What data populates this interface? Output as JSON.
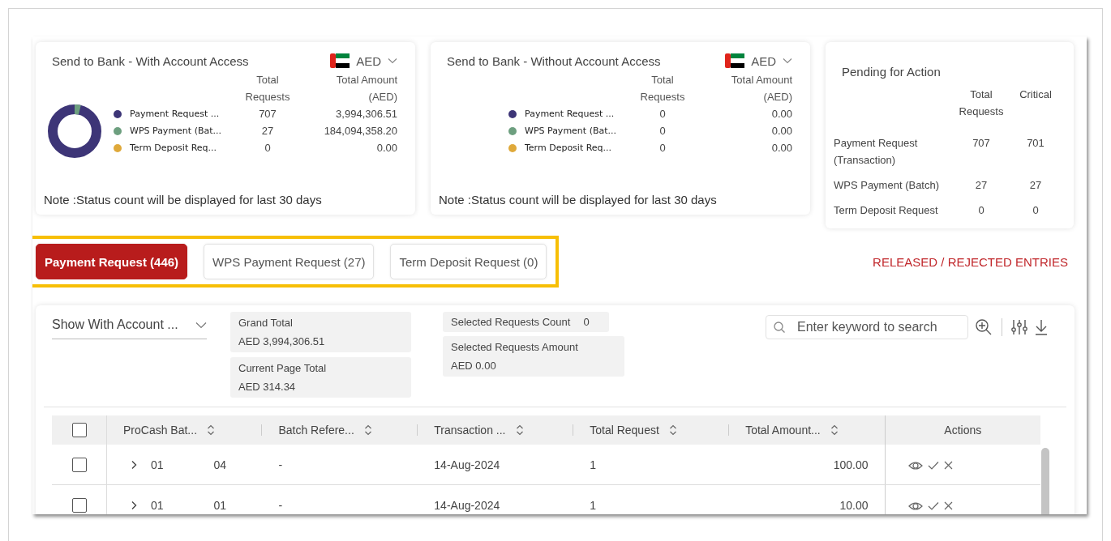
{
  "summary_cards": [
    {
      "title": "Send to Bank - With Account Access",
      "currency": "AED",
      "donut": true,
      "columns": [
        "Total Requests",
        "Total Amount (AED)"
      ],
      "rows": [
        {
          "label": "Payment Request ...",
          "color": "#3d3577",
          "requests": "707",
          "amount": "3,994,306.51"
        },
        {
          "label": "WPS Payment (Bat...",
          "color": "#6d9f7f",
          "requests": "27",
          "amount": "184,094,358.20"
        },
        {
          "label": "Term Deposit Req...",
          "color": "#dfa93a",
          "requests": "0",
          "amount": "0.00"
        }
      ],
      "note": "Note :Status count will be displayed for last 30 days"
    },
    {
      "title": "Send to Bank - Without Account Access",
      "currency": "AED",
      "donut": false,
      "columns": [
        "Total Requests",
        "Total Amount (AED)"
      ],
      "rows": [
        {
          "label": "Payment Request ...",
          "color": "#3d3577",
          "requests": "0",
          "amount": "0.00"
        },
        {
          "label": "WPS Payment (Bat...",
          "color": "#6d9f7f",
          "requests": "0",
          "amount": "0.00"
        },
        {
          "label": "Term Deposit Req...",
          "color": "#dfa93a",
          "requests": "0",
          "amount": "0.00"
        }
      ],
      "note": "Note :Status count will be displayed for last 30 days"
    }
  ],
  "pending": {
    "title": "Pending for Action",
    "columns": [
      "Total Requests",
      "Critical"
    ],
    "rows": [
      {
        "label": "Payment Request (Transaction)",
        "total": "707",
        "critical": "701"
      },
      {
        "label": "WPS Payment (Batch)",
        "total": "27",
        "critical": "27"
      },
      {
        "label": "Term Deposit Request",
        "total": "0",
        "critical": "0"
      }
    ]
  },
  "tabs": [
    {
      "label": "Payment Request (446)",
      "selected": true
    },
    {
      "label": "WPS Payment Request (27)",
      "selected": false
    },
    {
      "label": "Term Deposit Request (0)",
      "selected": false
    }
  ],
  "released_link": "RELEASED / REJECTED ENTRIES",
  "filter_select": {
    "value": "Show With Account ..."
  },
  "totals": [
    {
      "label": "Grand Total",
      "value": "AED 3,994,306.51"
    },
    {
      "label": "Current Page Total",
      "value": "AED 314.34"
    }
  ],
  "selection": [
    {
      "kind": "inline",
      "label": "Selected Requests Count",
      "value": "0"
    },
    {
      "kind": "stacked",
      "label": "Selected Requests Amount",
      "value": "AED 0.00"
    }
  ],
  "search": {
    "placeholder": "Enter keyword to search"
  },
  "table": {
    "select_all_checked": false,
    "columns": [
      "ProCash Bat...",
      "Batch Refere...",
      "Transaction ...",
      "Total Request",
      "Total Amount...",
      "Actions"
    ],
    "rows": [
      {
        "checked": false,
        "id_start": "01",
        "id_end": "04",
        "batch_ref": "-",
        "date": "14-Aug-2024",
        "total_request": "1",
        "amount": "100.00"
      },
      {
        "checked": false,
        "id_start": "01",
        "id_end": "01",
        "batch_ref": "-",
        "date": "14-Aug-2024",
        "total_request": "1",
        "amount": "10.00"
      }
    ]
  }
}
